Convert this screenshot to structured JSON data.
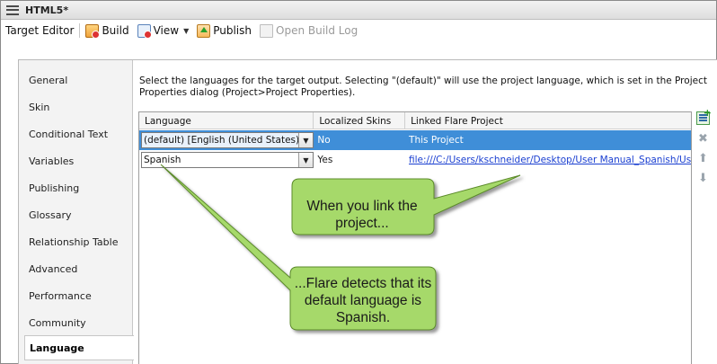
{
  "window": {
    "title": "HTML5*"
  },
  "toolbar": {
    "target_editor_label": "Target Editor",
    "build_label": "Build",
    "view_label": "View",
    "publish_label": "Publish",
    "open_build_log_label": "Open Build Log"
  },
  "sidebar": {
    "items": [
      {
        "label": "General"
      },
      {
        "label": "Skin"
      },
      {
        "label": "Conditional Text"
      },
      {
        "label": "Variables"
      },
      {
        "label": "Publishing"
      },
      {
        "label": "Glossary"
      },
      {
        "label": "Relationship Table"
      },
      {
        "label": "Advanced"
      },
      {
        "label": "Performance"
      },
      {
        "label": "Community"
      },
      {
        "label": "Language"
      }
    ],
    "active": "Language"
  },
  "main": {
    "description": "Select the languages for the target output. Selecting \"(default)\" will use the project language, which is set in the Project Properties dialog (Project>Project Properties).",
    "grid": {
      "headers": [
        "Language",
        "Localized Skins",
        "Linked Flare Project"
      ],
      "rows": [
        {
          "language": "(default) [English (United States)]",
          "localized_skins": "No",
          "linked_project": "This Project",
          "selected": true
        },
        {
          "language": "Spanish",
          "localized_skins": "Yes",
          "linked_project": "file:///C:/Users/kschneider/Desktop/User Manual_Spanish/User Ma",
          "selected": false
        }
      ]
    },
    "side_icons": [
      "add-language-icon",
      "delete-icon",
      "move-up-icon",
      "move-down-icon"
    ]
  },
  "callouts": [
    {
      "text": "When you link the project..."
    },
    {
      "text": "...Flare detects that its default language is Spanish."
    }
  ],
  "colors": {
    "selection": "#3f8ed8",
    "callout_fill": "#a6d96a",
    "link": "#1a3fd1"
  }
}
